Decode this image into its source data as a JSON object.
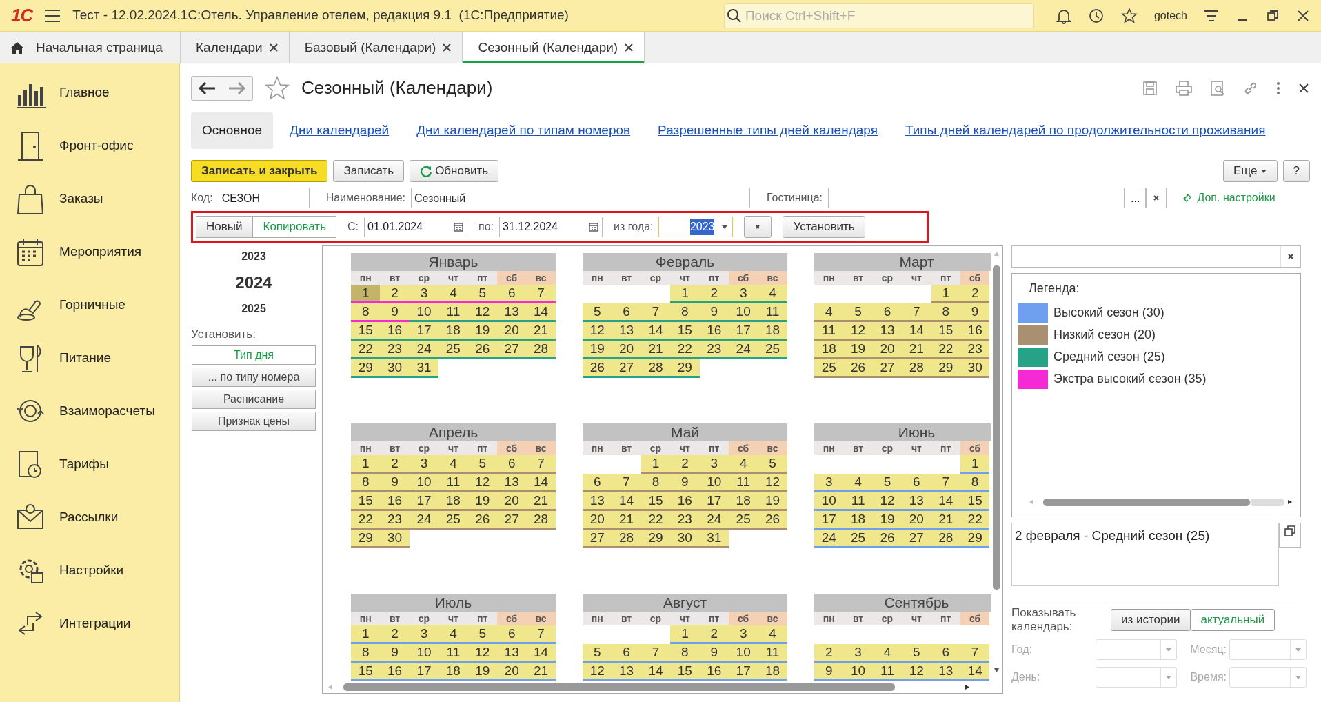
{
  "window": {
    "logo": "1С",
    "title": "Тест - 12.02.2024.1С:Отель. Управление отелем, редакция 9.1  (1С:Предприятие)",
    "search_placeholder": "Поиск Ctrl+Shift+F",
    "user": "gotech"
  },
  "tabs": [
    {
      "label": "Начальная страница",
      "selected": false,
      "home": true
    },
    {
      "label": "Календари",
      "selected": false,
      "home": false
    },
    {
      "label": "Базовый (Календари)",
      "selected": false,
      "home": false
    },
    {
      "label": "Сезонный (Календари)",
      "selected": true,
      "home": false
    }
  ],
  "sidebar": {
    "items": [
      {
        "label": "Главное"
      },
      {
        "label": "Фронт-офис"
      },
      {
        "label": "Заказы"
      },
      {
        "label": "Мероприятия"
      },
      {
        "label": "Горничные"
      },
      {
        "label": "Питание"
      },
      {
        "label": "Взаиморасчеты"
      },
      {
        "label": "Тарифы"
      },
      {
        "label": "Рассылки"
      },
      {
        "label": "Настройки"
      },
      {
        "label": "Интеграции"
      }
    ]
  },
  "form": {
    "title": "Сезонный (Календари)",
    "favorite": false,
    "sections": [
      {
        "label": "Основное",
        "selected": true
      },
      {
        "label": "Дни календарей",
        "selected": false
      },
      {
        "label": "Дни календарей по типам номеров",
        "selected": false
      },
      {
        "label": "Разрешенные типы дней календаря",
        "selected": false
      },
      {
        "label": "Типы дней календарей по продолжительности проживания",
        "selected": false
      }
    ],
    "buttons": [
      {
        "label": "Записать и закрыть",
        "kind": "primary"
      },
      {
        "label": "Записать",
        "kind": "plain"
      },
      {
        "label": "Обновить",
        "kind": "refresh"
      }
    ],
    "more": "Еще",
    "help": "?",
    "fields": [
      {
        "label": "Код:",
        "value": "СЕЗОН"
      },
      {
        "label": "Наименование:",
        "value": "Сезонный"
      },
      {
        "label": "Гостиница:",
        "select": "..."
      }
    ],
    "extra_link": "Доп. настройки",
    "period": {
      "modes": [
        {
          "label": "Новый",
          "selected": false
        },
        {
          "label": "Копировать",
          "selected": true
        }
      ],
      "from_label": "С:",
      "from": "01.01.2024",
      "to_label": "по:",
      "to": "31.12.2024",
      "year_label": "из года:",
      "year": "2023",
      "apply": "Установить"
    },
    "years": [
      {
        "label": "2023",
        "selected": false
      },
      {
        "label": "2024",
        "selected": true
      },
      {
        "label": "2025",
        "selected": false
      }
    ],
    "set_label": "Установить:",
    "set_buttons": [
      {
        "label": "Тип дня",
        "default": true
      },
      {
        "label": "... по типу номера",
        "default": false
      },
      {
        "label": "Расписание",
        "default": false
      },
      {
        "label": "Признак цены",
        "default": false
      }
    ],
    "months": [
      {
        "name": "Январь",
        "weekdays": [
          {
            "label": "пн",
            "weekend": false
          },
          {
            "label": "вт",
            "weekend": false
          },
          {
            "label": "ср",
            "weekend": false
          },
          {
            "label": "чт",
            "weekend": false
          },
          {
            "label": "пт",
            "weekend": false
          },
          {
            "label": "сб",
            "weekend": true
          },
          {
            "label": "вс",
            "weekend": true
          }
        ],
        "weeks": [
          [
            {
              "d": "1",
              "color": "#f52ad6",
              "selected": true
            },
            {
              "d": "2",
              "color": "#f52ad6",
              "selected": false
            },
            {
              "d": "3",
              "color": "#f52ad6",
              "selected": false
            },
            {
              "d": "4",
              "color": "#f52ad6",
              "selected": false
            },
            {
              "d": "5",
              "color": "#f52ad6",
              "selected": false
            },
            {
              "d": "6",
              "color": "#f52ad6",
              "selected": false
            },
            {
              "d": "7",
              "color": "#f52ad6",
              "selected": false
            }
          ],
          [
            {
              "d": "8",
              "color": "#f52ad6",
              "selected": false
            },
            {
              "d": "9",
              "color": "#f52ad6",
              "selected": false
            },
            {
              "d": "10",
              "color": "#26a387",
              "selected": false
            },
            {
              "d": "11",
              "color": "#26a387",
              "selected": false
            },
            {
              "d": "12",
              "color": "#26a387",
              "selected": false
            },
            {
              "d": "13",
              "color": "#26a387",
              "selected": false
            },
            {
              "d": "14",
              "color": "#26a387",
              "selected": false
            }
          ],
          [
            {
              "d": "15",
              "color": "#26a387",
              "selected": false
            },
            {
              "d": "16",
              "color": "#26a387",
              "selected": false
            },
            {
              "d": "17",
              "color": "#26a387",
              "selected": false
            },
            {
              "d": "18",
              "color": "#26a387",
              "selected": false
            },
            {
              "d": "19",
              "color": "#26a387",
              "selected": false
            },
            {
              "d": "20",
              "color": "#26a387",
              "selected": false
            },
            {
              "d": "21",
              "color": "#26a387",
              "selected": false
            }
          ],
          [
            {
              "d": "22",
              "color": "#26a387",
              "selected": false
            },
            {
              "d": "23",
              "color": "#26a387",
              "selected": false
            },
            {
              "d": "24",
              "color": "#26a387",
              "selected": false
            },
            {
              "d": "25",
              "color": "#26a387",
              "selected": false
            },
            {
              "d": "26",
              "color": "#26a387",
              "selected": false
            },
            {
              "d": "27",
              "color": "#26a387",
              "selected": false
            },
            {
              "d": "28",
              "color": "#26a387",
              "selected": false
            }
          ],
          [
            {
              "d": "29",
              "color": "#26a387",
              "selected": false
            },
            {
              "d": "30",
              "color": "#26a387",
              "selected": false
            },
            {
              "d": "31",
              "color": "#26a387",
              "selected": false
            }
          ]
        ]
      },
      {
        "name": "Февраль",
        "weekdays": [
          {
            "label": "пн",
            "weekend": false
          },
          {
            "label": "вт",
            "weekend": false
          },
          {
            "label": "ср",
            "weekend": false
          },
          {
            "label": "чт",
            "weekend": false
          },
          {
            "label": "пт",
            "weekend": false
          },
          {
            "label": "сб",
            "weekend": true
          },
          {
            "label": "вс",
            "weekend": true
          }
        ],
        "weeks": [
          [
            {
              "d": "1",
              "color": "#26a387",
              "selected": false
            },
            {
              "d": "2",
              "color": "#26a387",
              "selected": false
            },
            {
              "d": "3",
              "color": "#26a387",
              "selected": false
            },
            {
              "d": "4",
              "color": "#26a387",
              "selected": false
            }
          ],
          [
            {
              "d": "5",
              "color": "#26a387",
              "selected": false
            },
            {
              "d": "6",
              "color": "#26a387",
              "selected": false
            },
            {
              "d": "7",
              "color": "#26a387",
              "selected": false
            },
            {
              "d": "8",
              "color": "#26a387",
              "selected": false
            },
            {
              "d": "9",
              "color": "#26a387",
              "selected": false
            },
            {
              "d": "10",
              "color": "#26a387",
              "selected": false
            },
            {
              "d": "11",
              "color": "#26a387",
              "selected": false
            }
          ],
          [
            {
              "d": "12",
              "color": "#26a387",
              "selected": false
            },
            {
              "d": "13",
              "color": "#26a387",
              "selected": false
            },
            {
              "d": "14",
              "color": "#26a387",
              "selected": false
            },
            {
              "d": "15",
              "color": "#26a387",
              "selected": false
            },
            {
              "d": "16",
              "color": "#26a387",
              "selected": false
            },
            {
              "d": "17",
              "color": "#26a387",
              "selected": false
            },
            {
              "d": "18",
              "color": "#26a387",
              "selected": false
            }
          ],
          [
            {
              "d": "19",
              "color": "#26a387",
              "selected": false
            },
            {
              "d": "20",
              "color": "#26a387",
              "selected": false
            },
            {
              "d": "21",
              "color": "#26a387",
              "selected": false
            },
            {
              "d": "22",
              "color": "#26a387",
              "selected": false
            },
            {
              "d": "23",
              "color": "#26a387",
              "selected": false
            },
            {
              "d": "24",
              "color": "#26a387",
              "selected": false
            },
            {
              "d": "25",
              "color": "#26a387",
              "selected": false
            }
          ],
          [
            {
              "d": "26",
              "color": "#26a387",
              "selected": false
            },
            {
              "d": "27",
              "color": "#26a387",
              "selected": false
            },
            {
              "d": "28",
              "color": "#26a387",
              "selected": false
            },
            {
              "d": "29",
              "color": "#26a387",
              "selected": false
            }
          ]
        ]
      },
      {
        "name": "Март",
        "weekdays": [
          {
            "label": "пн",
            "weekend": false
          },
          {
            "label": "вт",
            "weekend": false
          },
          {
            "label": "ср",
            "weekend": false
          },
          {
            "label": "чт",
            "weekend": false
          },
          {
            "label": "пт",
            "weekend": false
          },
          {
            "label": "сб",
            "weekend": true
          }
        ],
        "weeks": [
          [
            {
              "d": "1",
              "color": "#a89070",
              "selected": false
            },
            {
              "d": "2",
              "color": "#a89070",
              "selected": false
            }
          ],
          [
            {
              "d": "4",
              "color": "#a89070",
              "selected": false
            },
            {
              "d": "5",
              "color": "#a89070",
              "selected": false
            },
            {
              "d": "6",
              "color": "#a89070",
              "selected": false
            },
            {
              "d": "7",
              "color": "#a89070",
              "selected": false
            },
            {
              "d": "8",
              "color": "#a89070",
              "selected": false
            },
            {
              "d": "9",
              "color": "#a89070",
              "selected": false
            }
          ],
          [
            {
              "d": "11",
              "color": "#a89070",
              "selected": false
            },
            {
              "d": "12",
              "color": "#a89070",
              "selected": false
            },
            {
              "d": "13",
              "color": "#a89070",
              "selected": false
            },
            {
              "d": "14",
              "color": "#a89070",
              "selected": false
            },
            {
              "d": "15",
              "color": "#a89070",
              "selected": false
            },
            {
              "d": "16",
              "color": "#a89070",
              "selected": false
            }
          ],
          [
            {
              "d": "18",
              "color": "#a89070",
              "selected": false
            },
            {
              "d": "19",
              "color": "#a89070",
              "selected": false
            },
            {
              "d": "20",
              "color": "#a89070",
              "selected": false
            },
            {
              "d": "21",
              "color": "#a89070",
              "selected": false
            },
            {
              "d": "22",
              "color": "#a89070",
              "selected": false
            },
            {
              "d": "23",
              "color": "#a89070",
              "selected": false
            }
          ],
          [
            {
              "d": "25",
              "color": "#a89070",
              "selected": false
            },
            {
              "d": "26",
              "color": "#a89070",
              "selected": false
            },
            {
              "d": "27",
              "color": "#a89070",
              "selected": false
            },
            {
              "d": "28",
              "color": "#a89070",
              "selected": false
            },
            {
              "d": "29",
              "color": "#a89070",
              "selected": false
            },
            {
              "d": "30",
              "color": "#a89070",
              "selected": false
            }
          ]
        ]
      },
      {
        "name": "Апрель",
        "weekdays": [
          {
            "label": "пн",
            "weekend": false
          },
          {
            "label": "вт",
            "weekend": false
          },
          {
            "label": "ср",
            "weekend": false
          },
          {
            "label": "чт",
            "weekend": false
          },
          {
            "label": "пт",
            "weekend": false
          },
          {
            "label": "сб",
            "weekend": true
          },
          {
            "label": "вс",
            "weekend": true
          }
        ],
        "weeks": [
          [
            {
              "d": "1",
              "color": "#a89070",
              "selected": false
            },
            {
              "d": "2",
              "color": "#a89070",
              "selected": false
            },
            {
              "d": "3",
              "color": "#a89070",
              "selected": false
            },
            {
              "d": "4",
              "color": "#a89070",
              "selected": false
            },
            {
              "d": "5",
              "color": "#a89070",
              "selected": false
            },
            {
              "d": "6",
              "color": "#a89070",
              "selected": false
            },
            {
              "d": "7",
              "color": "#a89070",
              "selected": false
            }
          ],
          [
            {
              "d": "8",
              "color": "#a89070",
              "selected": false
            },
            {
              "d": "9",
              "color": "#a89070",
              "selected": false
            },
            {
              "d": "10",
              "color": "#a89070",
              "selected": false
            },
            {
              "d": "11",
              "color": "#a89070",
              "selected": false
            },
            {
              "d": "12",
              "color": "#a89070",
              "selected": false
            },
            {
              "d": "13",
              "color": "#a89070",
              "selected": false
            },
            {
              "d": "14",
              "color": "#a89070",
              "selected": false
            }
          ],
          [
            {
              "d": "15",
              "color": "#a89070",
              "selected": false
            },
            {
              "d": "16",
              "color": "#a89070",
              "selected": false
            },
            {
              "d": "17",
              "color": "#a89070",
              "selected": false
            },
            {
              "d": "18",
              "color": "#a89070",
              "selected": false
            },
            {
              "d": "19",
              "color": "#a89070",
              "selected": false
            },
            {
              "d": "20",
              "color": "#a89070",
              "selected": false
            },
            {
              "d": "21",
              "color": "#a89070",
              "selected": false
            }
          ],
          [
            {
              "d": "22",
              "color": "#a89070",
              "selected": false
            },
            {
              "d": "23",
              "color": "#a89070",
              "selected": false
            },
            {
              "d": "24",
              "color": "#a89070",
              "selected": false
            },
            {
              "d": "25",
              "color": "#a89070",
              "selected": false
            },
            {
              "d": "26",
              "color": "#a89070",
              "selected": false
            },
            {
              "d": "27",
              "color": "#a89070",
              "selected": false
            },
            {
              "d": "28",
              "color": "#a89070",
              "selected": false
            }
          ],
          [
            {
              "d": "29",
              "color": "#a89070",
              "selected": false
            },
            {
              "d": "30",
              "color": "#a89070",
              "selected": false
            }
          ]
        ]
      },
      {
        "name": "Май",
        "weekdays": [
          {
            "label": "пн",
            "weekend": false
          },
          {
            "label": "вт",
            "weekend": false
          },
          {
            "label": "ср",
            "weekend": false
          },
          {
            "label": "чт",
            "weekend": false
          },
          {
            "label": "пт",
            "weekend": false
          },
          {
            "label": "сб",
            "weekend": true
          },
          {
            "label": "вс",
            "weekend": true
          }
        ],
        "weeks": [
          [
            {
              "d": "1",
              "color": "#a89070",
              "selected": false
            },
            {
              "d": "2",
              "color": "#a89070",
              "selected": false
            },
            {
              "d": "3",
              "color": "#a89070",
              "selected": false
            },
            {
              "d": "4",
              "color": "#a89070",
              "selected": false
            },
            {
              "d": "5",
              "color": "#a89070",
              "selected": false
            }
          ],
          [
            {
              "d": "6",
              "color": "#a89070",
              "selected": false
            },
            {
              "d": "7",
              "color": "#a89070",
              "selected": false
            },
            {
              "d": "8",
              "color": "#a89070",
              "selected": false
            },
            {
              "d": "9",
              "color": "#a89070",
              "selected": false
            },
            {
              "d": "10",
              "color": "#a89070",
              "selected": false
            },
            {
              "d": "11",
              "color": "#a89070",
              "selected": false
            },
            {
              "d": "12",
              "color": "#a89070",
              "selected": false
            }
          ],
          [
            {
              "d": "13",
              "color": "#a89070",
              "selected": false
            },
            {
              "d": "14",
              "color": "#a89070",
              "selected": false
            },
            {
              "d": "15",
              "color": "#a89070",
              "selected": false
            },
            {
              "d": "16",
              "color": "#a89070",
              "selected": false
            },
            {
              "d": "17",
              "color": "#a89070",
              "selected": false
            },
            {
              "d": "18",
              "color": "#a89070",
              "selected": false
            },
            {
              "d": "19",
              "color": "#a89070",
              "selected": false
            }
          ],
          [
            {
              "d": "20",
              "color": "#a89070",
              "selected": false
            },
            {
              "d": "21",
              "color": "#a89070",
              "selected": false
            },
            {
              "d": "22",
              "color": "#a89070",
              "selected": false
            },
            {
              "d": "23",
              "color": "#a89070",
              "selected": false
            },
            {
              "d": "24",
              "color": "#a89070",
              "selected": false
            },
            {
              "d": "25",
              "color": "#a89070",
              "selected": false
            },
            {
              "d": "26",
              "color": "#a89070",
              "selected": false
            }
          ],
          [
            {
              "d": "27",
              "color": "#a89070",
              "selected": false
            },
            {
              "d": "28",
              "color": "#a89070",
              "selected": false
            },
            {
              "d": "29",
              "color": "#a89070",
              "selected": false
            },
            {
              "d": "30",
              "color": "#a89070",
              "selected": false
            },
            {
              "d": "31",
              "color": "#a89070",
              "selected": false
            }
          ]
        ]
      },
      {
        "name": "Июнь",
        "weekdays": [
          {
            "label": "пн",
            "weekend": false
          },
          {
            "label": "вт",
            "weekend": false
          },
          {
            "label": "ср",
            "weekend": false
          },
          {
            "label": "чт",
            "weekend": false
          },
          {
            "label": "пт",
            "weekend": false
          },
          {
            "label": "сб",
            "weekend": true
          }
        ],
        "weeks": [
          [
            {
              "d": "1",
              "color": "#6fa0f0",
              "selected": false
            }
          ],
          [
            {
              "d": "3",
              "color": "#6fa0f0",
              "selected": false
            },
            {
              "d": "4",
              "color": "#6fa0f0",
              "selected": false
            },
            {
              "d": "5",
              "color": "#6fa0f0",
              "selected": false
            },
            {
              "d": "6",
              "color": "#6fa0f0",
              "selected": false
            },
            {
              "d": "7",
              "color": "#6fa0f0",
              "selected": false
            },
            {
              "d": "8",
              "color": "#6fa0f0",
              "selected": false
            }
          ],
          [
            {
              "d": "10",
              "color": "#6fa0f0",
              "selected": false
            },
            {
              "d": "11",
              "color": "#6fa0f0",
              "selected": false
            },
            {
              "d": "12",
              "color": "#6fa0f0",
              "selected": false
            },
            {
              "d": "13",
              "color": "#6fa0f0",
              "selected": false
            },
            {
              "d": "14",
              "color": "#6fa0f0",
              "selected": false
            },
            {
              "d": "15",
              "color": "#6fa0f0",
              "selected": false
            }
          ],
          [
            {
              "d": "17",
              "color": "#6fa0f0",
              "selected": false
            },
            {
              "d": "18",
              "color": "#6fa0f0",
              "selected": false
            },
            {
              "d": "19",
              "color": "#6fa0f0",
              "selected": false
            },
            {
              "d": "20",
              "color": "#6fa0f0",
              "selected": false
            },
            {
              "d": "21",
              "color": "#6fa0f0",
              "selected": false
            },
            {
              "d": "22",
              "color": "#6fa0f0",
              "selected": false
            }
          ],
          [
            {
              "d": "24",
              "color": "#6fa0f0",
              "selected": false
            },
            {
              "d": "25",
              "color": "#6fa0f0",
              "selected": false
            },
            {
              "d": "26",
              "color": "#6fa0f0",
              "selected": false
            },
            {
              "d": "27",
              "color": "#6fa0f0",
              "selected": false
            },
            {
              "d": "28",
              "color": "#6fa0f0",
              "selected": false
            },
            {
              "d": "29",
              "color": "#6fa0f0",
              "selected": false
            }
          ]
        ]
      },
      {
        "name": "Июль",
        "weekdays": [
          {
            "label": "пн",
            "weekend": false
          },
          {
            "label": "вт",
            "weekend": false
          },
          {
            "label": "ср",
            "weekend": false
          },
          {
            "label": "чт",
            "weekend": false
          },
          {
            "label": "пт",
            "weekend": false
          },
          {
            "label": "сб",
            "weekend": true
          },
          {
            "label": "вс",
            "weekend": true
          }
        ],
        "weeks": [
          [
            {
              "d": "1",
              "color": "#6fa0f0",
              "selected": false
            },
            {
              "d": "2",
              "color": "#6fa0f0",
              "selected": false
            },
            {
              "d": "3",
              "color": "#6fa0f0",
              "selected": false
            },
            {
              "d": "4",
              "color": "#6fa0f0",
              "selected": false
            },
            {
              "d": "5",
              "color": "#6fa0f0",
              "selected": false
            },
            {
              "d": "6",
              "color": "#6fa0f0",
              "selected": false
            },
            {
              "d": "7",
              "color": "#6fa0f0",
              "selected": false
            }
          ],
          [
            {
              "d": "8",
              "color": "#6fa0f0",
              "selected": false
            },
            {
              "d": "9",
              "color": "#6fa0f0",
              "selected": false
            },
            {
              "d": "10",
              "color": "#6fa0f0",
              "selected": false
            },
            {
              "d": "11",
              "color": "#6fa0f0",
              "selected": false
            },
            {
              "d": "12",
              "color": "#6fa0f0",
              "selected": false
            },
            {
              "d": "13",
              "color": "#6fa0f0",
              "selected": false
            },
            {
              "d": "14",
              "color": "#6fa0f0",
              "selected": false
            }
          ],
          [
            {
              "d": "15",
              "color": "#6fa0f0",
              "selected": false
            },
            {
              "d": "16",
              "color": "#6fa0f0",
              "selected": false
            },
            {
              "d": "17",
              "color": "#6fa0f0",
              "selected": false
            },
            {
              "d": "18",
              "color": "#6fa0f0",
              "selected": false
            },
            {
              "d": "19",
              "color": "#6fa0f0",
              "selected": false
            },
            {
              "d": "20",
              "color": "#6fa0f0",
              "selected": false
            },
            {
              "d": "21",
              "color": "#6fa0f0",
              "selected": false
            }
          ]
        ]
      },
      {
        "name": "Август",
        "weekdays": [
          {
            "label": "пн",
            "weekend": false
          },
          {
            "label": "вт",
            "weekend": false
          },
          {
            "label": "ср",
            "weekend": false
          },
          {
            "label": "чт",
            "weekend": false
          },
          {
            "label": "пт",
            "weekend": false
          },
          {
            "label": "сб",
            "weekend": true
          },
          {
            "label": "вс",
            "weekend": true
          }
        ],
        "weeks": [
          [
            {
              "d": "1",
              "color": "#6fa0f0",
              "selected": false
            },
            {
              "d": "2",
              "color": "#6fa0f0",
              "selected": false
            },
            {
              "d": "3",
              "color": "#6fa0f0",
              "selected": false
            },
            {
              "d": "4",
              "color": "#6fa0f0",
              "selected": false
            }
          ],
          [
            {
              "d": "5",
              "color": "#6fa0f0",
              "selected": false
            },
            {
              "d": "6",
              "color": "#6fa0f0",
              "selected": false
            },
            {
              "d": "7",
              "color": "#6fa0f0",
              "selected": false
            },
            {
              "d": "8",
              "color": "#6fa0f0",
              "selected": false
            },
            {
              "d": "9",
              "color": "#6fa0f0",
              "selected": false
            },
            {
              "d": "10",
              "color": "#6fa0f0",
              "selected": false
            },
            {
              "d": "11",
              "color": "#6fa0f0",
              "selected": false
            }
          ],
          [
            {
              "d": "12",
              "color": "#6fa0f0",
              "selected": false
            },
            {
              "d": "13",
              "color": "#6fa0f0",
              "selected": false
            },
            {
              "d": "14",
              "color": "#6fa0f0",
              "selected": false
            },
            {
              "d": "15",
              "color": "#6fa0f0",
              "selected": false
            },
            {
              "d": "16",
              "color": "#6fa0f0",
              "selected": false
            },
            {
              "d": "17",
              "color": "#6fa0f0",
              "selected": false
            },
            {
              "d": "18",
              "color": "#6fa0f0",
              "selected": false
            }
          ]
        ]
      },
      {
        "name": "Сентябрь",
        "first_week_hidden": true,
        "weekdays": [
          {
            "label": "пн",
            "weekend": false
          },
          {
            "label": "вт",
            "weekend": false
          },
          {
            "label": "ср",
            "weekend": false
          },
          {
            "label": "чт",
            "weekend": false
          },
          {
            "label": "пт",
            "weekend": false
          },
          {
            "label": "сб",
            "weekend": true
          }
        ],
        "weeks": [
          [
            {
              "d": "2",
              "color": "#6fa0f0",
              "selected": false
            },
            {
              "d": "3",
              "color": "#6fa0f0",
              "selected": false
            },
            {
              "d": "4",
              "color": "#6fa0f0",
              "selected": false
            },
            {
              "d": "5",
              "color": "#6fa0f0",
              "selected": false
            },
            {
              "d": "6",
              "color": "#6fa0f0",
              "selected": false
            },
            {
              "d": "7",
              "color": "#6fa0f0",
              "selected": false
            }
          ],
          [
            {
              "d": "9",
              "color": "#6fa0f0",
              "selected": false
            },
            {
              "d": "10",
              "color": "#6fa0f0",
              "selected": false
            },
            {
              "d": "11",
              "color": "#6fa0f0",
              "selected": false
            },
            {
              "d": "12",
              "color": "#6fa0f0",
              "selected": false
            },
            {
              "d": "13",
              "color": "#6fa0f0",
              "selected": false
            },
            {
              "d": "14",
              "color": "#6fa0f0",
              "selected": false
            }
          ]
        ]
      }
    ],
    "legend": {
      "title": "Легенда:",
      "items": [
        {
          "label": "Высокий сезон (30)",
          "color": "#6fa0f0"
        },
        {
          "label": "Низкий сезон (20)",
          "color": "#a89070"
        },
        {
          "label": "Средний сезон (25)",
          "color": "#26a387"
        },
        {
          "label": "Экстра высокий сезон (35)",
          "color": "#f52ad6"
        }
      ]
    },
    "selected_info": "2 февраля - Средний сезон (25)",
    "show_calendar": {
      "label": "Показывать календарь:",
      "options": [
        {
          "label": "из истории",
          "selected": false
        },
        {
          "label": "актуальный",
          "selected": true
        }
      ]
    },
    "filters": [
      {
        "label": "Год:",
        "disabled": true
      },
      {
        "label": "Месяц:",
        "disabled": true
      },
      {
        "label": "День:",
        "disabled": true
      },
      {
        "label": "Время:",
        "disabled": true
      }
    ]
  }
}
